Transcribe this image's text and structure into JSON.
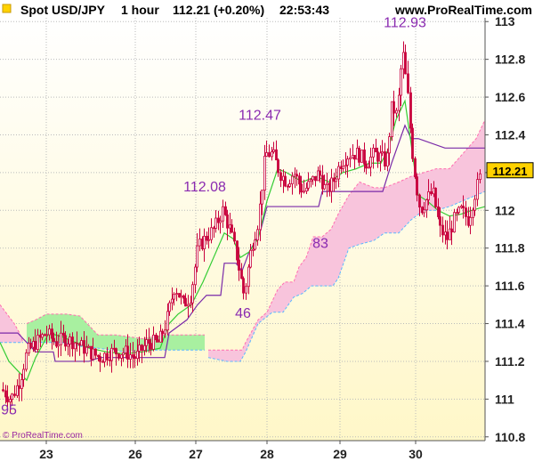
{
  "header": {
    "instrument": "Spot USD/JPY",
    "timeframe": "1 hour",
    "price_change": "112.21 (+0.20%)",
    "time": "22:53:43",
    "site": "www.ProRealTime.com"
  },
  "watermark": "© ProRealTime.com",
  "colors": {
    "candle": "#c8003c",
    "tenkan": "#33cc33",
    "kijun": "#7a2aa8",
    "cloud_bull": "#a8f0a0",
    "cloud_bear": "#f8c4dc",
    "annotation": "#8a2ab0",
    "price_tag_bg": "#ffd200",
    "grid": "#bbbbbb",
    "bg_top": "#ffffff",
    "bg_bottom": "#fff7c8"
  },
  "chart_data": {
    "type": "candlestick",
    "ylim": [
      110.78,
      113.02
    ],
    "y_ticks": [
      110.8,
      111,
      111.2,
      111.4,
      111.6,
      111.8,
      112,
      112.2,
      112.4,
      112.6,
      112.8,
      113
    ],
    "y_tick_labels": [
      "110.8",
      "111",
      "111.2",
      "111.4",
      "111.6",
      "111.8",
      "112",
      "112.2",
      "112.4",
      "112.6",
      "112.8",
      "113"
    ],
    "last_price": 112.21,
    "last_price_label": "112.21",
    "x_day_labels": [
      "23",
      "26",
      "27",
      "28",
      "29",
      "30"
    ],
    "annotations": [
      {
        "text": "95",
        "price": 110.95
      },
      {
        "text": "112.08",
        "price": 112.08
      },
      {
        "text": "112.47",
        "price": 112.47
      },
      {
        "text": "46",
        "price": 111.46
      },
      {
        "text": "83",
        "price": 111.83
      },
      {
        "text": "112.93",
        "price": 112.93
      }
    ]
  }
}
